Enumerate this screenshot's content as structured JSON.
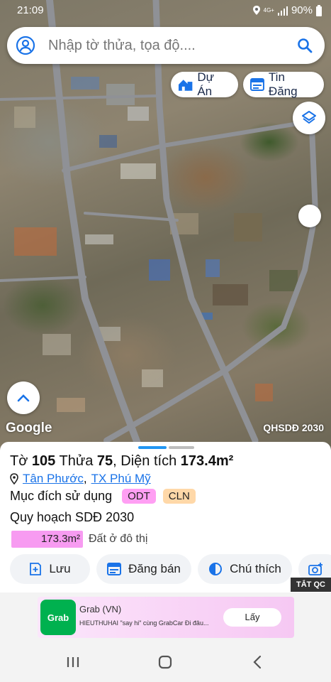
{
  "status_bar": {
    "time": "21:09",
    "network": "4G+",
    "battery": "90%"
  },
  "search": {
    "placeholder": "Nhập tờ thửa, tọa độ...."
  },
  "top_buttons": {
    "du_an": "Dự Án",
    "tin_dang": "Tin Đăng"
  },
  "map": {
    "attribution": "Google",
    "overlay_label": "QHSDĐ 2030"
  },
  "parcel": {
    "sheet_label": "Tờ",
    "sheet_no": "105",
    "lot_label": "Thửa",
    "lot_no": "75",
    "area_label": ", Diện tích",
    "area_value": "173.4m²",
    "ward": "Tân Phước",
    "separator": ",",
    "town": "TX Phú Mỹ",
    "purpose_label": "Mục đích sử dụng",
    "purpose_badges": [
      "ODT",
      "CLN"
    ],
    "plan_label": "Quy hoạch SDĐ 2030",
    "plan_area": "173.3m²",
    "plan_area_fraction": 1.0,
    "plan_type": "Đất ở đô thị"
  },
  "actions": {
    "save": "Lưu",
    "post": "Đăng bán",
    "legend": "Chú thích"
  },
  "ad": {
    "close_label": "TẮT QC",
    "logo_text": "Grab",
    "title": "Grab (VN)",
    "subtitle": "HIEUTHUHAI \"say hi\" cùng GrabCar Đi đâu...",
    "cta": "Lấy"
  },
  "colors": {
    "accent": "#1a73e8",
    "odt_badge": "#ff9ff3",
    "cln_badge": "#ffd8a8",
    "area_bar": "#f79bf1",
    "grab_green": "#00b14f"
  }
}
